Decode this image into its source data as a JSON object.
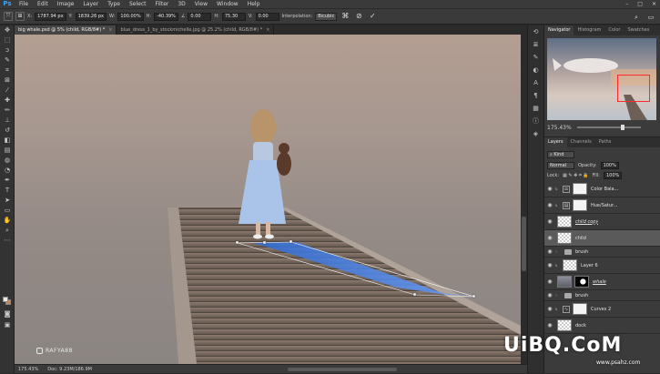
{
  "app": {
    "logo": "Ps"
  },
  "menu": [
    "File",
    "Edit",
    "Image",
    "Layer",
    "Type",
    "Select",
    "Filter",
    "3D",
    "View",
    "Window",
    "Help"
  ],
  "window_controls": [
    "–",
    "□",
    "✕"
  ],
  "options_bar": {
    "fields": [
      {
        "label": "X:",
        "value": "1787.94 px"
      },
      {
        "label": "Y:",
        "value": "1839.26 px"
      },
      {
        "label": "W:",
        "value": "100.00%"
      },
      {
        "label": "H:",
        "value": "-40.39%"
      },
      {
        "label": "∠",
        "value": "0.00"
      },
      {
        "label": "H:",
        "value": "75.30"
      },
      {
        "label": "V:",
        "value": "0.00"
      }
    ],
    "interpolation_label": "Interpolation:",
    "interpolation_value": "Bicubic",
    "warp_icon": "warp-icon",
    "cancel_icon": "cancel-icon",
    "commit_icon": "commit-check-icon"
  },
  "doc_tabs": [
    {
      "title": "big whale.psd @ 5% (child, RGB/8#) *",
      "active": true
    },
    {
      "title": "blue_dress_1_by_stockmichelle.jpg @ 25.2% (child, RGB/8#) *",
      "active": false
    }
  ],
  "status": {
    "zoom": "175.43%",
    "doc": "Doc: 9.23M/186.9M"
  },
  "watermark": "RAFYA88",
  "navigator": {
    "tabs": [
      "Navigator",
      "Histogram",
      "Color",
      "Swatches"
    ],
    "zoom": "175.43%"
  },
  "layers": {
    "tabs": [
      "Layers",
      "Channels",
      "Paths"
    ],
    "blend_mode": "Normal",
    "opacity_label": "Opacity:",
    "opacity": "100%",
    "lock_label": "Lock:",
    "fill_label": "Fill:",
    "fill": "100%",
    "items": [
      {
        "name": "Color Bala...",
        "thumb": "adj",
        "mask": "white",
        "type": "adjustment"
      },
      {
        "name": "Hue/Satur...",
        "thumb": "adj",
        "mask": "white",
        "type": "adjustment"
      },
      {
        "name": "child copy",
        "thumb": "transparent",
        "type": "pixel",
        "italic": true
      },
      {
        "name": "child",
        "thumb": "transparent",
        "type": "pixel",
        "selected": true
      },
      {
        "name": "brush",
        "type": "group"
      },
      {
        "name": "Layer 6",
        "thumb": "transparent",
        "type": "pixel"
      },
      {
        "name": "whale",
        "thumb": "photo",
        "mask": "black",
        "type": "pixel",
        "italic": true
      },
      {
        "name": "brush",
        "type": "group"
      },
      {
        "name": "Curves 2",
        "thumb": "adj",
        "mask": "white",
        "type": "adjustment"
      },
      {
        "name": "dock",
        "thumb": "transparent",
        "type": "pixel"
      }
    ]
  },
  "branding": {
    "name": "UiBQ.CoM",
    "sub": "www.psahz.com"
  }
}
